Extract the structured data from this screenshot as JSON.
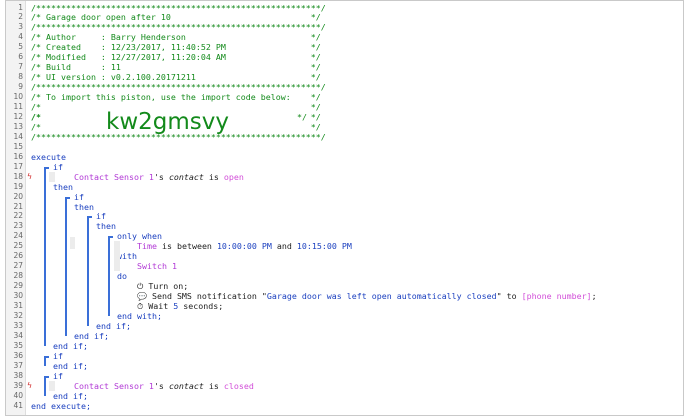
{
  "comment_lines": [
    "/*********************************************************/",
    "/* Garage door open after 10                            */",
    "/*********************************************************/",
    "/* Author     : Barry Henderson                         */",
    "/* Created    : 12/23/2017, 11:40:52 PM                 */",
    "/* Modified   : 12/27/2017, 11:20:04 AM                 */",
    "/* Build      : 11                                      */",
    "/* UI version : v0.2.100.20171211                       */",
    "/*********************************************************/",
    "/* To import this piston, use the import code below:    */",
    "/*                                                      */"
  ],
  "import_line_prefix": "/*",
  "import_line_suffix": "*/",
  "import_code": "kw2gmsvy",
  "blank_comment_line": "/*                                                      */",
  "end_comment_line": "/*********************************************************/",
  "kw": {
    "execute": "execute",
    "if": "if",
    "then": "then",
    "end_if": "end if;",
    "only_when": "only when",
    "with": "with",
    "do": "do",
    "end_with": "end with;",
    "end_execute": "end execute;"
  },
  "cond1": {
    "device": "Contact Sensor 1",
    "poss": "'s ",
    "attr": "contact",
    "is": " is ",
    "value": "open"
  },
  "cond2": {
    "subject": "Time",
    "text": " is between ",
    "from": "10:00:00 PM",
    "and": " and ",
    "to": "10:15:00 PM"
  },
  "with_device": "Switch 1",
  "actions": [
    {
      "icon": "power-icon",
      "glyph": "⏻",
      "text": " Turn on;"
    },
    {
      "icon": "chat-icon",
      "glyph": "💬",
      "text_pre": " Send SMS notification \"",
      "msg": "Garage door was left open automatically closed",
      "text_mid": "\" to ",
      "var": "[phone number]",
      "text_post": ";"
    },
    {
      "icon": "clock-icon",
      "glyph": "⏱",
      "text": " Wait ",
      "num": "5",
      "unit": " seconds;"
    }
  ],
  "cond3": {
    "device": "Contact Sensor 1",
    "poss": "'s ",
    "attr": "contact",
    "is": " is ",
    "value": "closed"
  },
  "line_numbers": [
    "1",
    "2",
    "3",
    "4",
    "5",
    "6",
    "7",
    "8",
    "9",
    "10",
    "11",
    "12",
    "13",
    "14",
    "15",
    "16",
    "17",
    "18",
    "19",
    "20",
    "21",
    "22",
    "23",
    "24",
    "25",
    "26",
    "27",
    "28",
    "29",
    "30",
    "31",
    "32",
    "33",
    "34",
    "35",
    "36",
    "37",
    "38",
    "39",
    "40",
    "41"
  ],
  "breakpoint_glyph": "ϟ"
}
